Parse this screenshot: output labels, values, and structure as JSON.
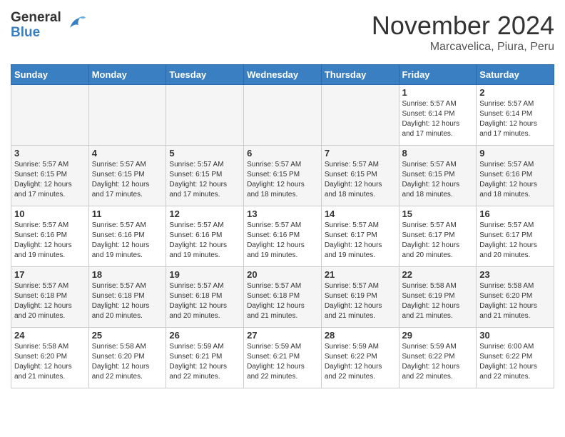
{
  "header": {
    "logo_line1": "General",
    "logo_line2": "Blue",
    "month": "November 2024",
    "location": "Marcavelica, Piura, Peru"
  },
  "weekdays": [
    "Sunday",
    "Monday",
    "Tuesday",
    "Wednesday",
    "Thursday",
    "Friday",
    "Saturday"
  ],
  "weeks": [
    [
      {
        "day": "",
        "info": "",
        "empty": true
      },
      {
        "day": "",
        "info": "",
        "empty": true
      },
      {
        "day": "",
        "info": "",
        "empty": true
      },
      {
        "day": "",
        "info": "",
        "empty": true
      },
      {
        "day": "",
        "info": "",
        "empty": true
      },
      {
        "day": "1",
        "info": "Sunrise: 5:57 AM\nSunset: 6:14 PM\nDaylight: 12 hours and 17 minutes."
      },
      {
        "day": "2",
        "info": "Sunrise: 5:57 AM\nSunset: 6:14 PM\nDaylight: 12 hours and 17 minutes."
      }
    ],
    [
      {
        "day": "3",
        "info": "Sunrise: 5:57 AM\nSunset: 6:15 PM\nDaylight: 12 hours and 17 minutes."
      },
      {
        "day": "4",
        "info": "Sunrise: 5:57 AM\nSunset: 6:15 PM\nDaylight: 12 hours and 17 minutes."
      },
      {
        "day": "5",
        "info": "Sunrise: 5:57 AM\nSunset: 6:15 PM\nDaylight: 12 hours and 17 minutes."
      },
      {
        "day": "6",
        "info": "Sunrise: 5:57 AM\nSunset: 6:15 PM\nDaylight: 12 hours and 18 minutes."
      },
      {
        "day": "7",
        "info": "Sunrise: 5:57 AM\nSunset: 6:15 PM\nDaylight: 12 hours and 18 minutes."
      },
      {
        "day": "8",
        "info": "Sunrise: 5:57 AM\nSunset: 6:15 PM\nDaylight: 12 hours and 18 minutes."
      },
      {
        "day": "9",
        "info": "Sunrise: 5:57 AM\nSunset: 6:16 PM\nDaylight: 12 hours and 18 minutes."
      }
    ],
    [
      {
        "day": "10",
        "info": "Sunrise: 5:57 AM\nSunset: 6:16 PM\nDaylight: 12 hours and 19 minutes."
      },
      {
        "day": "11",
        "info": "Sunrise: 5:57 AM\nSunset: 6:16 PM\nDaylight: 12 hours and 19 minutes."
      },
      {
        "day": "12",
        "info": "Sunrise: 5:57 AM\nSunset: 6:16 PM\nDaylight: 12 hours and 19 minutes."
      },
      {
        "day": "13",
        "info": "Sunrise: 5:57 AM\nSunset: 6:16 PM\nDaylight: 12 hours and 19 minutes."
      },
      {
        "day": "14",
        "info": "Sunrise: 5:57 AM\nSunset: 6:17 PM\nDaylight: 12 hours and 19 minutes."
      },
      {
        "day": "15",
        "info": "Sunrise: 5:57 AM\nSunset: 6:17 PM\nDaylight: 12 hours and 20 minutes."
      },
      {
        "day": "16",
        "info": "Sunrise: 5:57 AM\nSunset: 6:17 PM\nDaylight: 12 hours and 20 minutes."
      }
    ],
    [
      {
        "day": "17",
        "info": "Sunrise: 5:57 AM\nSunset: 6:18 PM\nDaylight: 12 hours and 20 minutes."
      },
      {
        "day": "18",
        "info": "Sunrise: 5:57 AM\nSunset: 6:18 PM\nDaylight: 12 hours and 20 minutes."
      },
      {
        "day": "19",
        "info": "Sunrise: 5:57 AM\nSunset: 6:18 PM\nDaylight: 12 hours and 20 minutes."
      },
      {
        "day": "20",
        "info": "Sunrise: 5:57 AM\nSunset: 6:18 PM\nDaylight: 12 hours and 21 minutes."
      },
      {
        "day": "21",
        "info": "Sunrise: 5:57 AM\nSunset: 6:19 PM\nDaylight: 12 hours and 21 minutes."
      },
      {
        "day": "22",
        "info": "Sunrise: 5:58 AM\nSunset: 6:19 PM\nDaylight: 12 hours and 21 minutes."
      },
      {
        "day": "23",
        "info": "Sunrise: 5:58 AM\nSunset: 6:20 PM\nDaylight: 12 hours and 21 minutes."
      }
    ],
    [
      {
        "day": "24",
        "info": "Sunrise: 5:58 AM\nSunset: 6:20 PM\nDaylight: 12 hours and 21 minutes."
      },
      {
        "day": "25",
        "info": "Sunrise: 5:58 AM\nSunset: 6:20 PM\nDaylight: 12 hours and 22 minutes."
      },
      {
        "day": "26",
        "info": "Sunrise: 5:59 AM\nSunset: 6:21 PM\nDaylight: 12 hours and 22 minutes."
      },
      {
        "day": "27",
        "info": "Sunrise: 5:59 AM\nSunset: 6:21 PM\nDaylight: 12 hours and 22 minutes."
      },
      {
        "day": "28",
        "info": "Sunrise: 5:59 AM\nSunset: 6:22 PM\nDaylight: 12 hours and 22 minutes."
      },
      {
        "day": "29",
        "info": "Sunrise: 5:59 AM\nSunset: 6:22 PM\nDaylight: 12 hours and 22 minutes."
      },
      {
        "day": "30",
        "info": "Sunrise: 6:00 AM\nSunset: 6:22 PM\nDaylight: 12 hours and 22 minutes."
      }
    ]
  ]
}
